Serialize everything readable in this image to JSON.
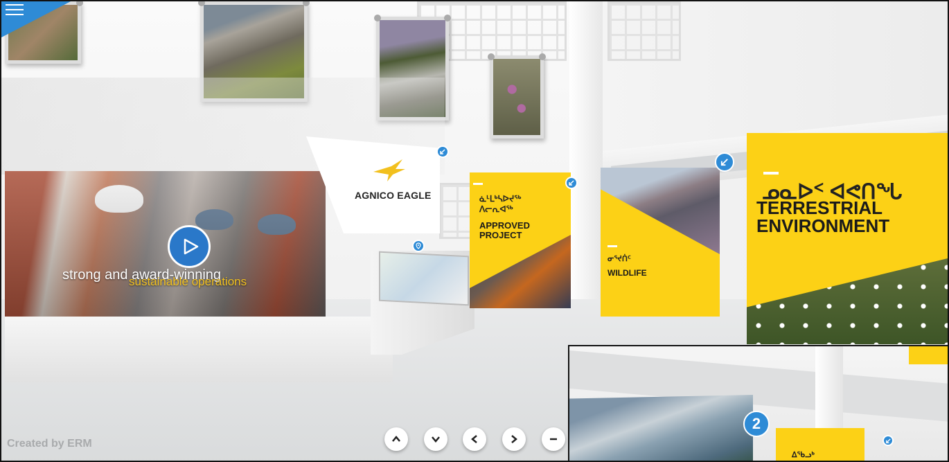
{
  "menu": {
    "icon": "hamburger-menu-icon"
  },
  "video": {
    "line1": "strong and award-winning",
    "line2": "sustainable operations",
    "play_icon": "play-icon"
  },
  "agnico": {
    "name": "AGNICO EAGLE"
  },
  "panels": {
    "approved": {
      "syllabic_line1": "ᓈᒻᒪᒃᓴᐅᔪᖅ",
      "syllabic_line2": "ᐱᓕᕆᐊᖅ",
      "title_line1": "APPROVED",
      "title_line2": "PROJECT"
    },
    "wildlife": {
      "syllabic": "ᓂᕐᔪᑏᑦ",
      "title": "WILDLIFE"
    },
    "terrestrial": {
      "syllabic": "ᓄᓇᐅᑉ ᐊᕙᑎᖓ",
      "title_line1": "TERRESTRIAL",
      "title_line2": "ENVIRONMENT"
    }
  },
  "credit": "Created by ERM",
  "nav": [
    {
      "name": "up",
      "icon": "chevron-up-icon"
    },
    {
      "name": "down",
      "icon": "chevron-down-icon"
    },
    {
      "name": "left",
      "icon": "chevron-left-icon"
    },
    {
      "name": "right",
      "icon": "chevron-right-icon"
    },
    {
      "name": "zoom-out",
      "icon": "minus-icon"
    }
  ],
  "inset": {
    "badge": "2",
    "syllabic": "ᐃᖃᓗᒃ"
  },
  "colors": {
    "accent_blue": "#2e8bd6",
    "brand_yellow": "#fcd116"
  }
}
